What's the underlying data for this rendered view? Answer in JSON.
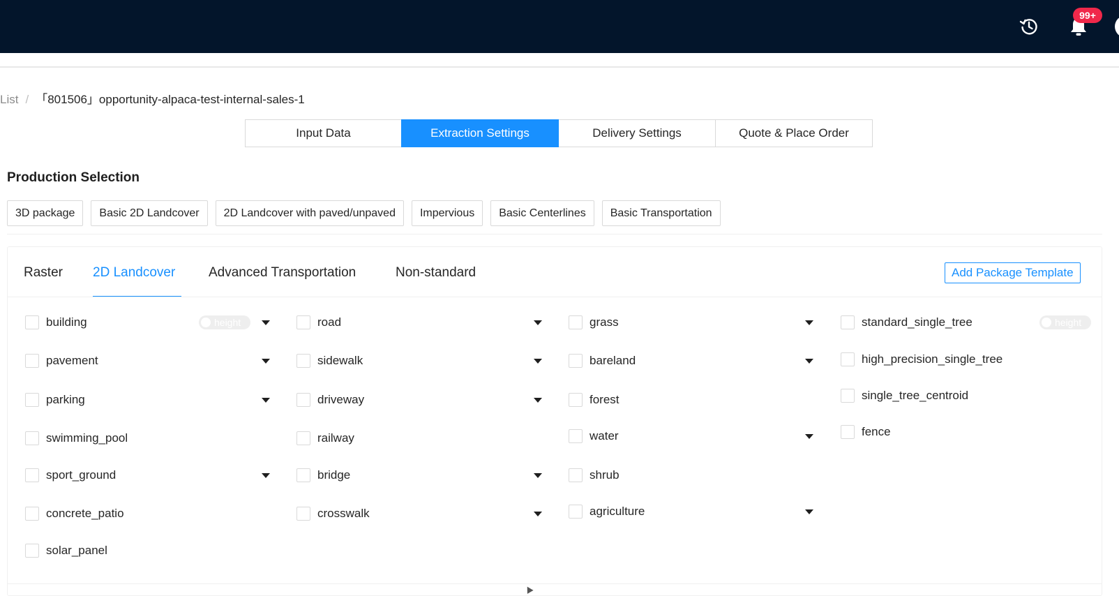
{
  "header": {
    "notification_badge": "99+",
    "icons": [
      "history-icon",
      "bell-icon",
      "avatar"
    ],
    "colors": {
      "background": "#03152b",
      "badge": "#f0284a"
    }
  },
  "breadcrumb": {
    "previous": "List",
    "separator": "/",
    "current": "「801506」opportunity-alpaca-test-internal-sales-1"
  },
  "steps": [
    {
      "label": "Input Data",
      "active": false
    },
    {
      "label": "Extraction Settings",
      "active": true
    },
    {
      "label": "Delivery Settings",
      "active": false
    },
    {
      "label": "Quote & Place Order",
      "active": false
    }
  ],
  "production": {
    "title": "Production Selection",
    "presets": [
      "3D package",
      "Basic 2D Landcover",
      "2D Landcover with paved/unpaved",
      "Impervious",
      "Basic Centerlines",
      "Basic Transportation"
    ]
  },
  "panel": {
    "tabs": [
      {
        "label": "Raster",
        "active": false
      },
      {
        "label": "2D Landcover",
        "active": true
      },
      {
        "label": "Advanced Transportation",
        "active": false
      },
      {
        "label": "Non-standard",
        "active": false
      }
    ],
    "add_template_label": "Add Package Template",
    "toggle_label": "height",
    "columns": [
      [
        {
          "label": "building",
          "checked": false,
          "toggle": true,
          "dropdown": true
        },
        {
          "label": "pavement",
          "checked": false,
          "dropdown": true
        },
        {
          "label": "parking",
          "checked": false,
          "dropdown": true
        },
        {
          "label": "swimming_pool",
          "checked": false
        },
        {
          "label": "sport_ground",
          "checked": false,
          "dropdown": true
        },
        {
          "label": "concrete_patio",
          "checked": false
        },
        {
          "label": "solar_panel",
          "checked": false
        }
      ],
      [
        {
          "label": "road",
          "checked": false,
          "dropdown": true
        },
        {
          "label": "sidewalk",
          "checked": false,
          "dropdown": true
        },
        {
          "label": "driveway",
          "checked": false,
          "dropdown": true
        },
        {
          "label": "railway",
          "checked": false
        },
        {
          "label": "bridge",
          "checked": false,
          "dropdown": true
        },
        {
          "label": "crosswalk",
          "checked": false,
          "dropdown": true
        }
      ],
      [
        {
          "label": "grass",
          "checked": false,
          "dropdown": true
        },
        {
          "label": "bareland",
          "checked": false,
          "dropdown": true
        },
        {
          "label": "forest",
          "checked": false
        },
        {
          "label": "water",
          "checked": false,
          "dropdown": true
        },
        {
          "label": "shrub",
          "checked": false
        },
        {
          "label": "agriculture",
          "checked": false,
          "dropdown": true
        }
      ],
      [
        {
          "label": "standard_single_tree",
          "checked": false,
          "toggle": true
        },
        {
          "label": "high_precision_single_tree",
          "checked": false
        },
        {
          "label": "single_tree_centroid",
          "checked": false
        },
        {
          "label": "fence",
          "checked": false
        }
      ]
    ]
  },
  "accent_color": "#1890ff"
}
